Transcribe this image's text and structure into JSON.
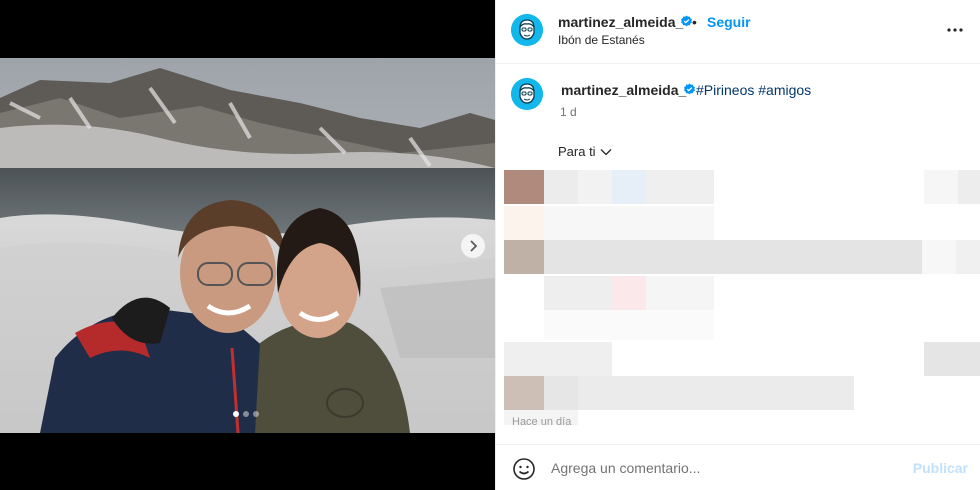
{
  "author": {
    "username": "martinez_almeida_",
    "location": "Ibón de Estanés",
    "verified": true
  },
  "header": {
    "separator": "•",
    "follow_label": "Seguir",
    "more_icon": "ellipsis-icon"
  },
  "caption": {
    "username": "martinez_almeida_",
    "hashtags": [
      "#Pirineos",
      "#amigos"
    ],
    "time": "1 d"
  },
  "comments": {
    "sort_label": "Para ti"
  },
  "footer": {
    "posted_ago": "Hace un día"
  },
  "composer": {
    "emoji_icon": "smiley-icon",
    "placeholder": "Agrega un comentario...",
    "publish_label": "Publicar"
  },
  "carousel": {
    "slide_count": 3,
    "active_slide": 1,
    "next_icon": "chevron-right-icon"
  },
  "colors": {
    "link_blue": "#0095f6",
    "hashtag_blue": "#00376b",
    "avatar_blue": "#12b8eb",
    "publish_disabled": "#c1e1fb"
  }
}
